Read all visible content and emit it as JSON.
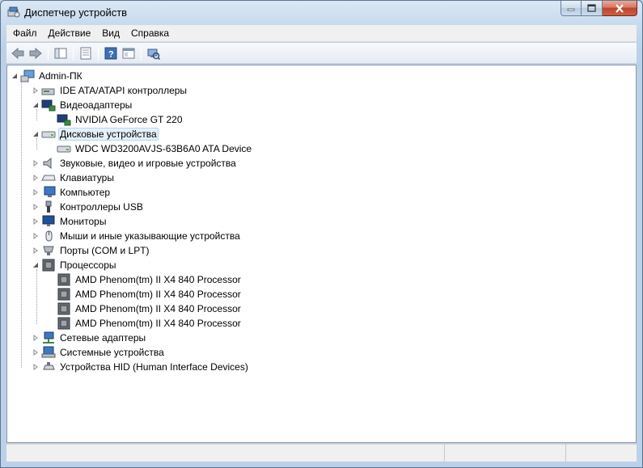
{
  "window": {
    "title": "Диспетчер устройств",
    "icon": "device-manager-icon"
  },
  "menu": [
    "Файл",
    "Действие",
    "Вид",
    "Справка"
  ],
  "toolbar": {
    "buttons": [
      "back-icon",
      "forward-icon",
      "show-hide-tree-icon",
      "properties-icon",
      "help-icon",
      "console-view-icon",
      "scan-hardware-icon"
    ]
  },
  "tree": {
    "root": "Admin-ПК",
    "nodes": [
      {
        "label": "IDE ATA/ATAPI контроллеры",
        "icon": "ide-controller-icon",
        "expanded": false
      },
      {
        "label": "Видеоадаптеры",
        "icon": "display-adapter-icon",
        "expanded": true
      },
      {
        "label": "NVIDIA GeForce GT 220",
        "icon": "display-adapter-icon",
        "child": true
      },
      {
        "label": "Дисковые устройства",
        "icon": "disk-drive-icon",
        "expanded": true,
        "selected": true
      },
      {
        "label": "WDC WD3200AVJS-63B6A0 ATA Device",
        "icon": "disk-drive-icon",
        "child": true
      },
      {
        "label": "Звуковые, видео и игровые устройства",
        "icon": "speaker-icon",
        "expanded": false
      },
      {
        "label": "Клавиатуры",
        "icon": "keyboard-icon",
        "expanded": false
      },
      {
        "label": "Компьютер",
        "icon": "computer-icon",
        "expanded": false
      },
      {
        "label": "Контроллеры USB",
        "icon": "usb-icon",
        "expanded": false
      },
      {
        "label": "Мониторы",
        "icon": "monitor-icon",
        "expanded": false
      },
      {
        "label": "Мыши и иные указывающие устройства",
        "icon": "mouse-icon",
        "expanded": false
      },
      {
        "label": "Порты (COM и LPT)",
        "icon": "port-icon",
        "expanded": false
      },
      {
        "label": "Процессоры",
        "icon": "processor-icon",
        "expanded": true
      },
      {
        "label": "AMD Phenom(tm) II X4 840 Processor",
        "icon": "processor-icon",
        "child": true
      },
      {
        "label": "AMD Phenom(tm) II X4 840 Processor",
        "icon": "processor-icon",
        "child": true
      },
      {
        "label": "AMD Phenom(tm) II X4 840 Processor",
        "icon": "processor-icon",
        "child": true
      },
      {
        "label": "AMD Phenom(tm) II X4 840 Processor",
        "icon": "processor-icon",
        "child": true
      },
      {
        "label": "Сетевые адаптеры",
        "icon": "network-adapter-icon",
        "expanded": false
      },
      {
        "label": "Системные устройства",
        "icon": "system-devices-icon",
        "expanded": false
      },
      {
        "label": "Устройства HID (Human Interface Devices)",
        "icon": "hid-icon",
        "expanded": false
      }
    ]
  },
  "colors": {
    "selection_bg": "#e5f0fb",
    "selection_border": "#b6d5f3",
    "close_button": "#c0432c"
  }
}
